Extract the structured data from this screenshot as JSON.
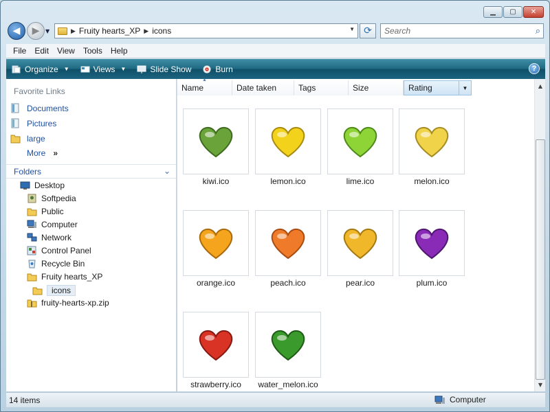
{
  "address": {
    "crumbs": [
      "Fruity hearts_XP",
      "icons"
    ]
  },
  "search": {
    "placeholder": "Search"
  },
  "menu": [
    "File",
    "Edit",
    "View",
    "Tools",
    "Help"
  ],
  "commands": {
    "organize": "Organize",
    "views": "Views",
    "slideshow": "Slide Show",
    "burn": "Burn",
    "help": "?"
  },
  "favorites": {
    "title": "Favorite Links",
    "items": [
      "Documents",
      "Pictures",
      "large"
    ],
    "more": "More",
    "more_chevron": "»"
  },
  "folders": {
    "title": "Folders",
    "tree": [
      "Desktop",
      "Softpedia",
      "Public",
      "Computer",
      "Network",
      "Control Panel",
      "Recycle Bin",
      "Fruity hearts_XP",
      "icons",
      "fruity-hearts-xp.zip"
    ]
  },
  "columns": [
    "Name",
    "Date taken",
    "Tags",
    "Size",
    "Rating"
  ],
  "files": [
    {
      "name": "kiwi.ico",
      "color": "#6aa33a"
    },
    {
      "name": "lemon.ico",
      "color": "#f2d21b"
    },
    {
      "name": "lime.ico",
      "color": "#8fd437"
    },
    {
      "name": "melon.ico",
      "color": "#f1d34a"
    },
    {
      "name": "orange.ico",
      "color": "#f5a41d"
    },
    {
      "name": "peach.ico",
      "color": "#ef7b2a"
    },
    {
      "name": "pear.ico",
      "color": "#f0b72a"
    },
    {
      "name": "plum.ico",
      "color": "#8a2bb8"
    },
    {
      "name": "strawberry.ico",
      "color": "#d93326"
    },
    {
      "name": "water_melon.ico",
      "color": "#3a9a2c"
    }
  ],
  "status": {
    "items": "14 items",
    "location": "Computer"
  }
}
